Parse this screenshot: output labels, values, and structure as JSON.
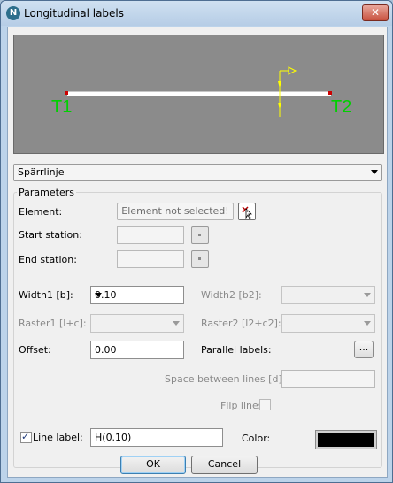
{
  "window": {
    "title": "Longitudinal labels",
    "app_icon": "N"
  },
  "preview": {
    "start_label": "T1",
    "end_label": "T2",
    "colors": {
      "background": "#8b8b8b",
      "line": "#ffffff",
      "labels": "#00d000",
      "marker": "#ffff00"
    }
  },
  "line_type": {
    "selected": "Spärrlinje"
  },
  "parameters": {
    "group_title": "Parameters",
    "element_label": "Element:",
    "element_button": "Element not selected!",
    "start_station_label": "Start station:",
    "end_station_label": "End station:",
    "width1_label": "Width1 [b]:",
    "width1_value": "0.10",
    "width2_label": "Width2 [b2]:",
    "raster1_label": "Raster1 [l+c]:",
    "raster2_label": "Raster2 [l2+c2]:",
    "offset_label": "Offset:",
    "offset_value": "0.00",
    "parallel_label": "Parallel labels:",
    "parallel_button": "...",
    "space_label": "Space between lines [d]:",
    "flip_label": "Flip lines",
    "line_label_check": "Line label:",
    "line_label_checked": true,
    "line_label_value": "H(0.10)",
    "color_label": "Color:",
    "color_value": "#000000"
  },
  "footer": {
    "ok": "OK",
    "cancel": "Cancel"
  }
}
